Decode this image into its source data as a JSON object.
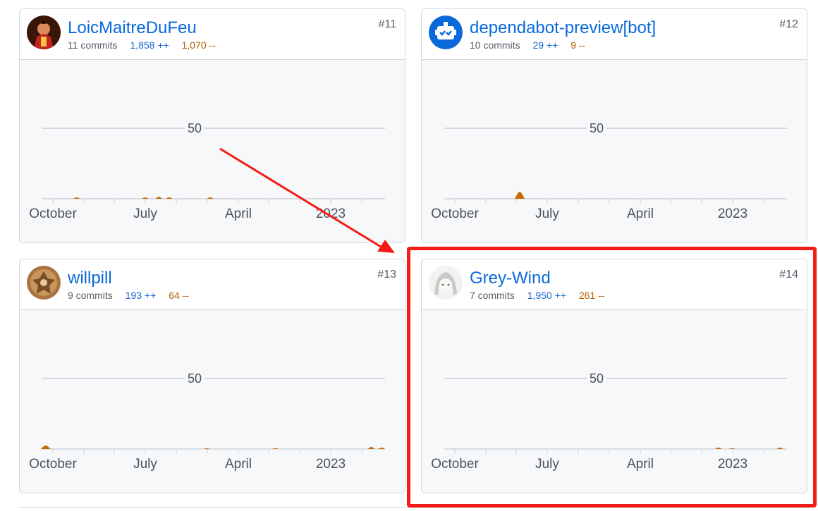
{
  "chart_scale": {
    "gridline_value": 50,
    "x_axis_labels": [
      "October",
      "July",
      "April",
      "2023"
    ]
  },
  "colors": {
    "link": "#0969da",
    "additions": "#1a66d2",
    "deletions": "#b35900",
    "area_fill": "#c76b00",
    "annotation": "#f31c17"
  },
  "contributors": [
    {
      "username": "LoicMaitreDuFeu",
      "rank": "#11",
      "commits": "11 commits",
      "additions": "1,858 ++",
      "deletions": "1,070 --",
      "avatar_icon": "red-character-avatar",
      "activity_bumps": [
        {
          "x": 0.1,
          "h": 2
        },
        {
          "x": 0.3,
          "h": 2
        },
        {
          "x": 0.34,
          "h": 3
        },
        {
          "x": 0.37,
          "h": 2
        },
        {
          "x": 0.49,
          "h": 2
        }
      ]
    },
    {
      "username": "dependabot-preview[bot]",
      "rank": "#12",
      "commits": "10 commits",
      "additions": "29 ++",
      "deletions": "9 --",
      "avatar_icon": "robot-avatar",
      "activity_bumps": [
        {
          "x": 0.22,
          "h": 10
        }
      ]
    },
    {
      "username": "willpill",
      "rank": "#13",
      "commits": "9 commits",
      "additions": "193 ++",
      "deletions": "64 --",
      "avatar_icon": "emblem-avatar",
      "activity_bumps": [
        {
          "x": 0.01,
          "h": 5
        },
        {
          "x": 0.48,
          "h": 1
        },
        {
          "x": 0.68,
          "h": 1
        },
        {
          "x": 0.96,
          "h": 3
        },
        {
          "x": 0.99,
          "h": 2
        }
      ]
    },
    {
      "username": "Grey-Wind",
      "rank": "#14",
      "commits": "7 commits",
      "additions": "1,950 ++",
      "deletions": "261 --",
      "avatar_icon": "anime-character-avatar",
      "activity_bumps": [
        {
          "x": 0.8,
          "h": 2
        },
        {
          "x": 0.84,
          "h": 1
        },
        {
          "x": 0.98,
          "h": 2
        }
      ]
    }
  ]
}
